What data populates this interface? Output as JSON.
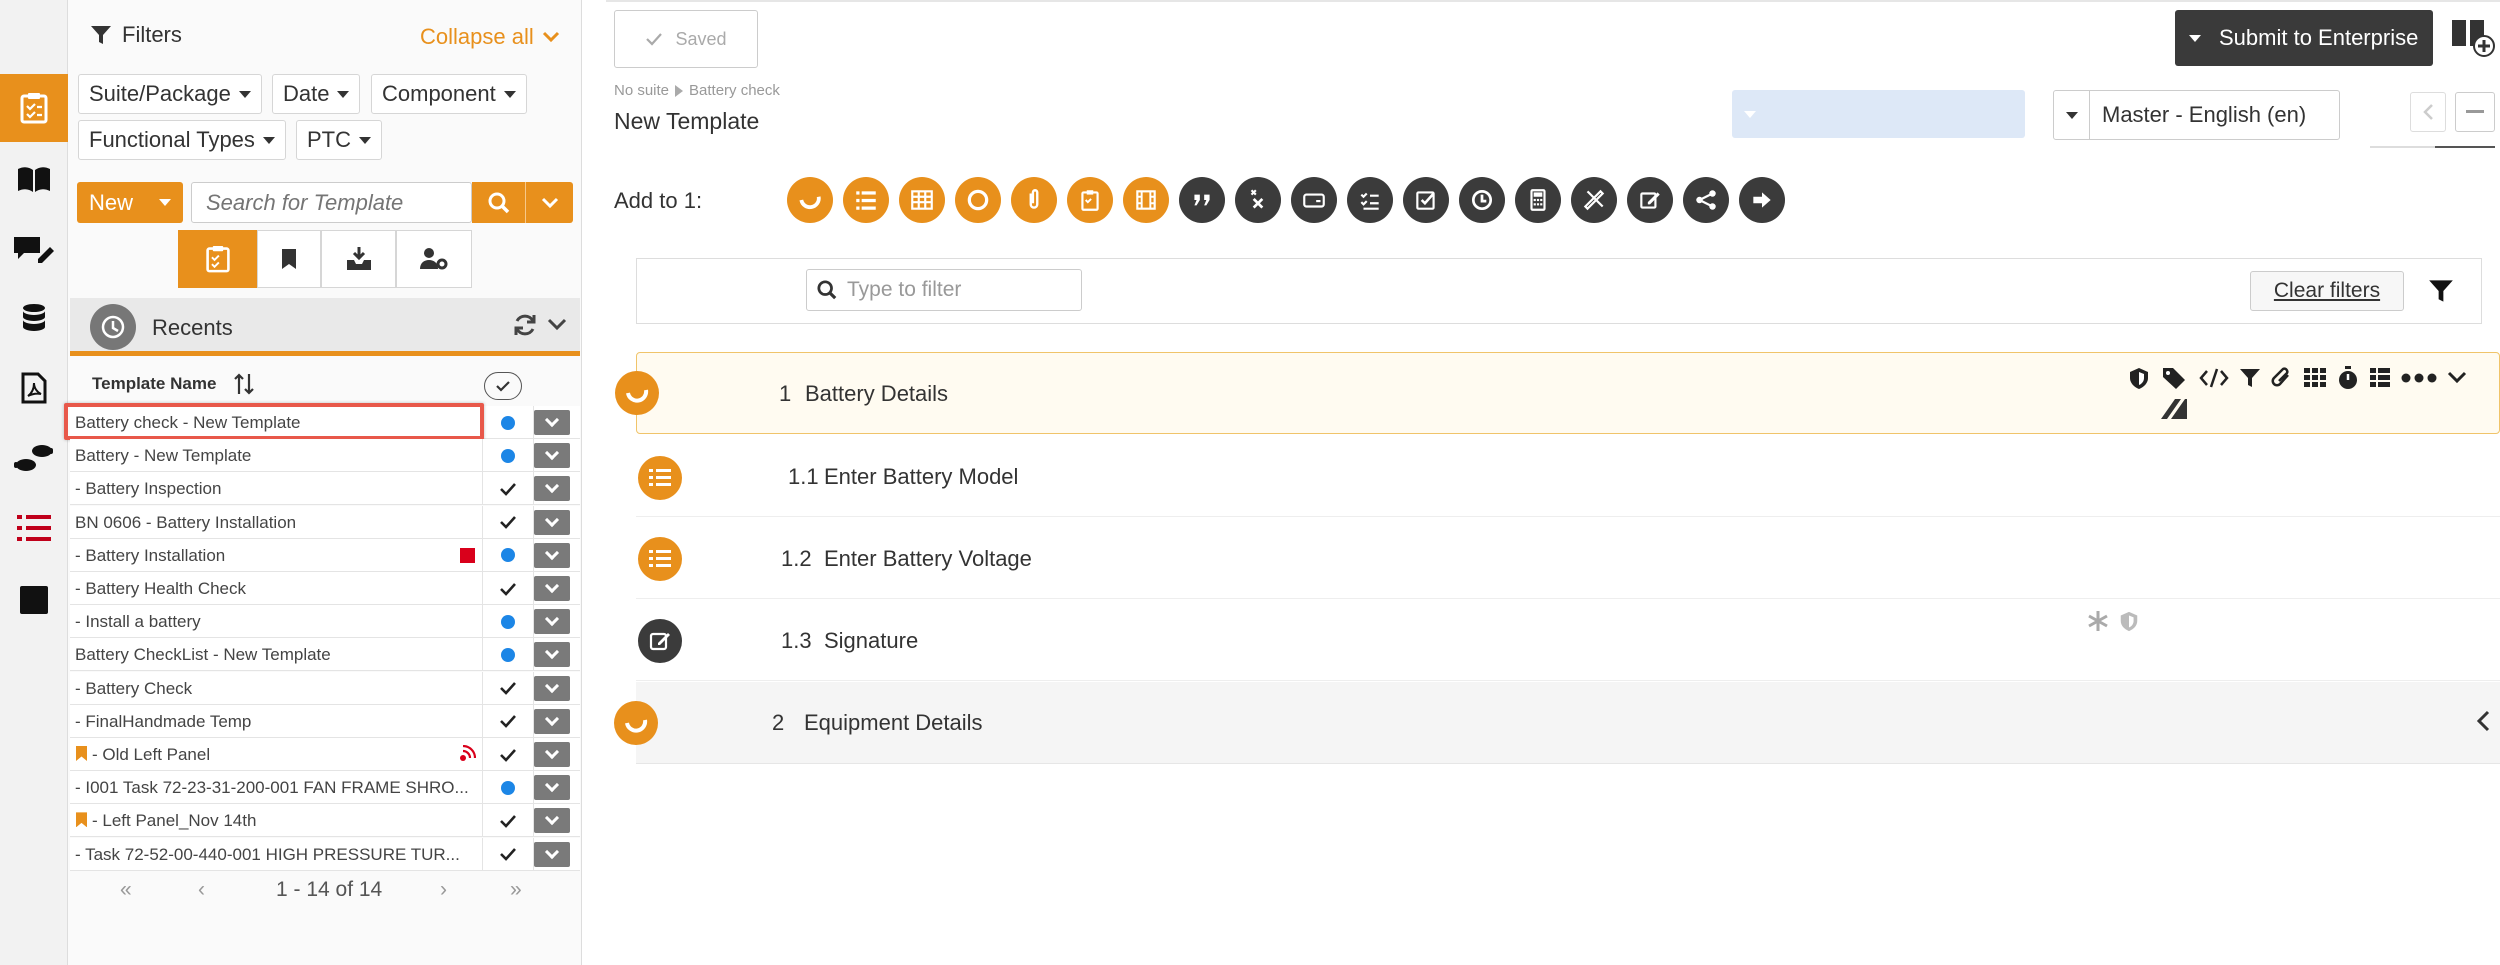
{
  "colors": {
    "accent": "#e8901c",
    "dark": "#3b3b3b",
    "blue_dot": "#1c86e6",
    "red_flag": "#d9001b"
  },
  "filters": {
    "title": "Filters",
    "collapse_label": "Collapse all",
    "chips": [
      "Suite/Package",
      "Date",
      "Component",
      "Functional Types",
      "PTC"
    ]
  },
  "search": {
    "new_label": "New",
    "placeholder": "Search for Template"
  },
  "recents": {
    "label": "Recents"
  },
  "grid": {
    "column_name": "Template Name",
    "rows": [
      {
        "name": "Battery check - New Template",
        "status": "dot",
        "selected": true
      },
      {
        "name": "Battery - New Template",
        "status": "dot"
      },
      {
        "name": "- Battery Inspection",
        "status": "check"
      },
      {
        "name": "BN 0606 - Battery Installation",
        "status": "check"
      },
      {
        "name": "- Battery Installation",
        "status": "dot",
        "flag": "red-square"
      },
      {
        "name": "- Battery Health Check",
        "status": "check"
      },
      {
        "name": "- Install a battery",
        "status": "dot"
      },
      {
        "name": "Battery CheckList - New Template",
        "status": "dot"
      },
      {
        "name": "- Battery Check",
        "status": "check"
      },
      {
        "name": "- FinalHandmade Temp",
        "status": "check"
      },
      {
        "name": "- Old Left Panel",
        "status": "check",
        "bookmark": true,
        "flag": "signal"
      },
      {
        "name": "- I001 Task 72-23-31-200-001 FAN FRAME SHRO...",
        "status": "dot"
      },
      {
        "name": "- Left Panel_Nov 14th",
        "status": "check",
        "bookmark": true
      },
      {
        "name": "- Task 72-52-00-440-001 HIGH PRESSURE TUR...",
        "status": "check"
      }
    ]
  },
  "pager": {
    "first": "«",
    "prev": "‹",
    "range": "1 - 14 of 14",
    "next": "›",
    "last": "»"
  },
  "toolbar": {
    "saved_label": "Saved",
    "submit_label": "Submit to Enterprise"
  },
  "breadcrumb": {
    "suite": "No suite",
    "item": "Battery check"
  },
  "template_title": "New Template",
  "language": {
    "selected": "Master - English (en)"
  },
  "add_to_label": "Add to 1:",
  "add_tools": [
    {
      "icon": "section-icon",
      "tone": "o"
    },
    {
      "icon": "list-icon",
      "tone": "o"
    },
    {
      "icon": "table-icon",
      "tone": "o"
    },
    {
      "icon": "circle-icon",
      "tone": "o"
    },
    {
      "icon": "attachment-icon",
      "tone": "o"
    },
    {
      "icon": "clipboard-icon",
      "tone": "o"
    },
    {
      "icon": "film-icon",
      "tone": "o"
    },
    {
      "icon": "quote-icon",
      "tone": "d"
    },
    {
      "icon": "cross-check-icon",
      "tone": "d"
    },
    {
      "icon": "card-icon",
      "tone": "d"
    },
    {
      "icon": "checklist-icon",
      "tone": "d"
    },
    {
      "icon": "checkbox-icon",
      "tone": "d"
    },
    {
      "icon": "clock-icon",
      "tone": "d"
    },
    {
      "icon": "calculator-icon",
      "tone": "d"
    },
    {
      "icon": "ruler-pencil-icon",
      "tone": "d"
    },
    {
      "icon": "edit-icon",
      "tone": "d"
    },
    {
      "icon": "share-icon",
      "tone": "d"
    },
    {
      "icon": "arrow-right-icon",
      "tone": "d"
    }
  ],
  "filter": {
    "placeholder": "Type to filter",
    "clear_label": "Clear filters"
  },
  "structure": {
    "sections": [
      {
        "num": "1",
        "label": "Battery Details"
      },
      {
        "num": "2",
        "label": "Equipment Details"
      }
    ],
    "items": [
      {
        "num": "1.1",
        "label": "Enter Battery Model"
      },
      {
        "num": "1.2",
        "label": "Enter Battery Voltage"
      },
      {
        "num": "1.3",
        "label": "Signature"
      }
    ]
  }
}
